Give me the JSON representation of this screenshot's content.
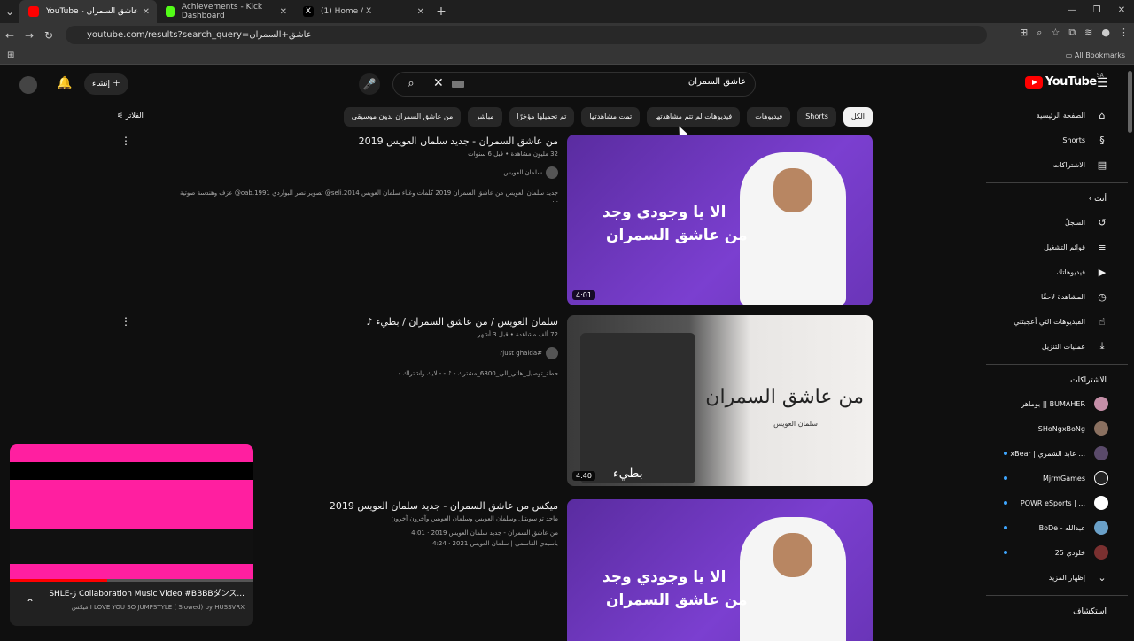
{
  "browser": {
    "tabs": [
      {
        "label": "YouTube - عاشق السمران",
        "color": "#ff0000"
      },
      {
        "label": "Achievements - Kick Dashboard",
        "color": "#53fc18"
      },
      {
        "label": "(1) Home / X",
        "color": "#000000"
      }
    ],
    "url": "youtube.com/results?search_query=عاشق+السمران",
    "bookmarks_label": "All Bookmarks"
  },
  "header": {
    "create_label": "إنشاء",
    "search_value": "عاشق السمران",
    "logo_text": "YouTube",
    "region": "SA"
  },
  "filters": {
    "filter_label": "الفلاتر",
    "chips": [
      "الكل",
      "Shorts",
      "فيديوهات",
      "فيديوهات لم تتم مشاهدتها",
      "تمت مشاهدتها",
      "تم تحميلها مؤخرًا",
      "مباشر",
      "من عاشق السمران بدون موسيقى"
    ]
  },
  "results": [
    {
      "title": "من عاشق السمران - جديد سلمان العويس 2019",
      "meta": "32 مليون مشاهدة • قبل 6 سنوات",
      "channel": "سلمان العويس",
      "desc": "جديد سلمان العويس من عاشق السمران 2019 كلمات وغناء سلمان العويس seli.2014@ تصوير نصر البواردي oab.1991@ عزف وهندسة صوتية ...",
      "duration": "4:01",
      "thumb_line1": "الا يا وجودي وجد",
      "thumb_line2": "من عاشق السمران"
    },
    {
      "title": "سلمان العويس / من عاشق السمران / بطيء ♪",
      "meta": "72 ألف مشاهدة • قبل 3 أشهر",
      "channel": "#just ghaida?",
      "desc": "حطة_توصيل_هاتي_الي_6800_مشترك - ♪ - - لايك واشتراك -",
      "duration": "4:40",
      "thumb_line1": "من عاشق السمران",
      "thumb_line2": "سلمان العويس",
      "thumb_tag": "بطيء"
    },
    {
      "title": "ميكس من عاشق السمران - جديد سلمان العويس 2019",
      "meta": "ماجد تو سوبتيل وسلمان العويس وسلمان العويس وآخرون آخرون",
      "channel": "من عاشق السمران - جديد سلمان العويس 2019 · 4:01",
      "desc": "باسيدي القاسمي | سلمان العويس 2021 · 4:24",
      "thumb_line1": "الا يا وجودي وجد",
      "thumb_line2": "من عاشق السمران"
    }
  ],
  "sidebar": {
    "main": [
      {
        "label": "الصفحة الرئيسية",
        "icon": "home-icon",
        "glyph": "⌂"
      },
      {
        "label": "Shorts",
        "icon": "shorts-icon",
        "glyph": "§"
      },
      {
        "label": "الاشتراكات",
        "icon": "subscriptions-icon",
        "glyph": "▤"
      }
    ],
    "you_label": "أنت",
    "you": [
      {
        "label": "السجلّ",
        "icon": "history-icon",
        "glyph": "↺"
      },
      {
        "label": "قوائم التشغيل",
        "icon": "playlists-icon",
        "glyph": "≡"
      },
      {
        "label": "فيديوهاتك",
        "icon": "your-videos-icon",
        "glyph": "▶"
      },
      {
        "label": "المشاهدة لاحقًا",
        "icon": "watch-later-icon",
        "glyph": "◷"
      },
      {
        "label": "الفيديوهات التي أعجبتني",
        "icon": "liked-icon",
        "glyph": "👍"
      },
      {
        "label": "عمليات التنزيل",
        "icon": "download-icon",
        "glyph": "⤓"
      }
    ],
    "subs_label": "الاشتراكات",
    "subs": [
      {
        "label": "بوماهر || BUMAHER",
        "color": "#c58fa8",
        "dot": false
      },
      {
        "label": "SHoNgxBoNg",
        "color": "#8a7060",
        "dot": false
      },
      {
        "label": "xBear | عابد الشمري ...",
        "color": "#5a4a6a",
        "dot": true
      },
      {
        "label": "MjrmGames",
        "color": "#222222",
        "dot": true
      },
      {
        "label": "POWR eSports | ...",
        "color": "#ffffff",
        "dot": true
      },
      {
        "label": "BoDe - عبدالله",
        "color": "#6aa0c8",
        "dot": true
      },
      {
        "label": "خلودي 25",
        "color": "#7a3030",
        "dot": true
      }
    ],
    "show_more": "إظهار المزيد",
    "explore": "استكشاف"
  },
  "mini_player": {
    "title": "SHLE-ز Collaboration Music Video #BBBBダンス...",
    "subtitle": "ميكس I LOVE YOU SO JUMPSTYLE ( Slowed) by HUSSVRX",
    "progress": 0.4
  }
}
